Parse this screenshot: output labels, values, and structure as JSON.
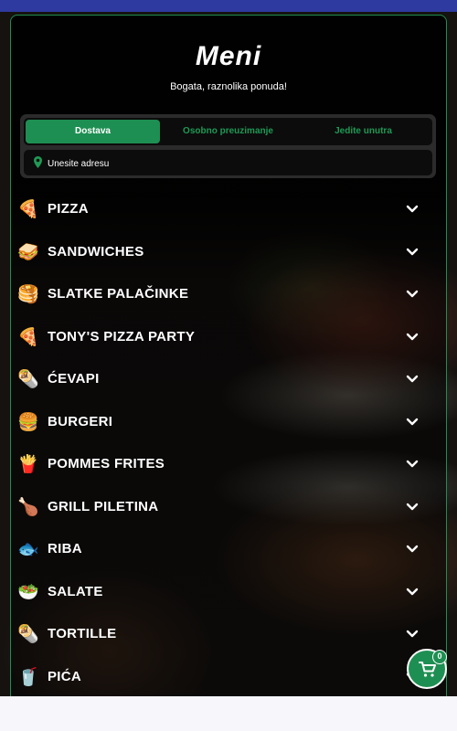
{
  "header": {
    "title": "Meni",
    "subtitle": "Bogata, raznolika ponuda!"
  },
  "order_type": {
    "tabs": [
      {
        "label": "Dostava",
        "active": true
      },
      {
        "label": "Osobno preuzimanje",
        "active": false
      },
      {
        "label": "Jedite unutra",
        "active": false
      }
    ]
  },
  "address": {
    "placeholder": "Unesite adresu",
    "value": ""
  },
  "categories": [
    {
      "label": "PIZZA",
      "icon": "🍕",
      "icon_name": "pizza-icon"
    },
    {
      "label": "SANDWICHES",
      "icon": "🥪",
      "icon_name": "sandwich-icon"
    },
    {
      "label": "SLATKE PALAČINKE",
      "icon": "🥞",
      "icon_name": "pancake-icon"
    },
    {
      "label": "TONY'S PIZZA PARTY",
      "icon": "🍕",
      "icon_name": "pizza-party-icon"
    },
    {
      "label": "ĆEVAPI",
      "icon": "🌯",
      "icon_name": "cevapi-icon"
    },
    {
      "label": "BURGERI",
      "icon": "🍔",
      "icon_name": "burger-icon"
    },
    {
      "label": "POMMES FRITES",
      "icon": "🍟",
      "icon_name": "fries-icon"
    },
    {
      "label": "GRILL PILETINA",
      "icon": "🍗",
      "icon_name": "grilled-chicken-icon"
    },
    {
      "label": "RIBA",
      "icon": "🐟",
      "icon_name": "fish-icon"
    },
    {
      "label": "SALATE",
      "icon": "🥗",
      "icon_name": "salad-icon"
    },
    {
      "label": "TORTILLE",
      "icon": "🌯",
      "icon_name": "tortilla-icon"
    },
    {
      "label": "PIĆA",
      "icon": "🥤",
      "icon_name": "drink-icon"
    }
  ],
  "cart": {
    "count": "0"
  },
  "colors": {
    "accent": "#1e8f52",
    "panel_border": "#1f8f4f",
    "top_bar": "#2e3a9f"
  }
}
